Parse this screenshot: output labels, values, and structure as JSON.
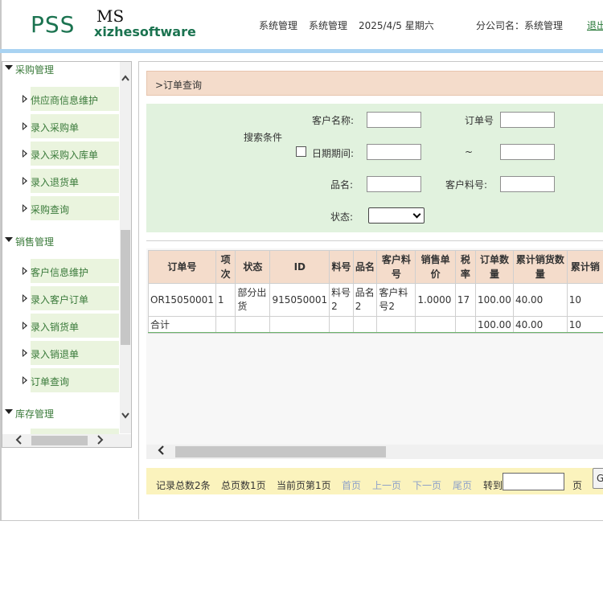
{
  "header": {
    "logo_main": "PSS",
    "logo_ms": "MS",
    "logo_sub": "xizhesoftware",
    "nav1": "系统管理",
    "nav2": "系统管理",
    "date": "2025/4/5 星期六",
    "company": "分公司名：系统管理",
    "logout": "退出"
  },
  "sidebar": {
    "groups": [
      {
        "label": "采购管理",
        "items": [
          "供应商信息维护",
          "录入采购单",
          "录入采购入库单",
          "录入退货单",
          "采购查询"
        ]
      },
      {
        "label": "销售管理",
        "items": [
          "客户信息维护",
          "录入客户订单",
          "录入销货单",
          "录入销退单",
          "订单查询"
        ]
      },
      {
        "label": "库存管理",
        "items": []
      }
    ]
  },
  "page": {
    "title": ">订单查询"
  },
  "search": {
    "heading": "搜索条件",
    "customer_name_label": "客户名称:",
    "order_no_label": "订单号",
    "date_label": "日期期间:",
    "date_sep": "~",
    "product_label": "品名:",
    "customer_part_label": "客户料号:",
    "status_label": "状态:",
    "customer_name_value": "",
    "order_no_value": "",
    "date_from_value": "",
    "date_to_value": "",
    "product_value": "",
    "customer_part_value": "",
    "status_value": ""
  },
  "grid": {
    "headers": [
      "订单号",
      "项次",
      "状态",
      "ID",
      "料号",
      "品名",
      "客户料号",
      "销售单价",
      "税率",
      "订单数量",
      "累计销货数量",
      "累计销"
    ],
    "rows": [
      [
        "OR15050001",
        "1",
        "部分出货",
        "915050001",
        "料号2",
        "品名2",
        "客户料号2",
        "1.0000",
        "17",
        "100.00",
        "40.00",
        "10"
      ]
    ],
    "total": [
      "合计",
      "",
      "",
      "",
      "",
      "",
      "",
      "",
      "",
      "100.00",
      "40.00",
      "10"
    ]
  },
  "pager": {
    "total_records": "记录总数2条",
    "total_pages": "总页数1页",
    "current_page": "当前页第1页",
    "first": "首页",
    "prev": "上一页",
    "next": "下一页",
    "last": "尾页",
    "goto": "转到",
    "page_unit": "页",
    "go_button": "G"
  },
  "colors": {
    "brand_green": "#1b7350",
    "header_bar": "#a9d3f2",
    "sidebar_item_bg": "#eaf4de",
    "title_bar_bg": "#f4dccb",
    "search_bg": "#e1f2de",
    "pager_bg": "#fbf3bd"
  }
}
